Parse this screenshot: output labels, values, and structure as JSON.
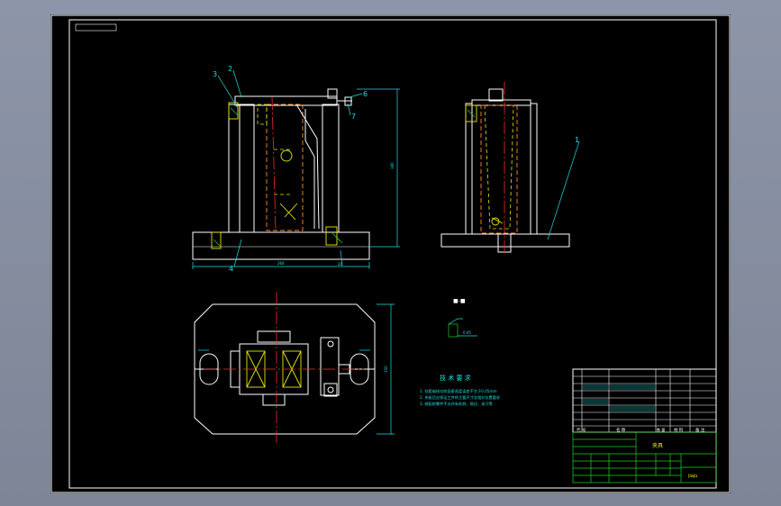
{
  "drawing": {
    "title_block": {
      "drawing_name": "夹具",
      "drawing_code": "jiaju"
    },
    "technical_requirements": {
      "heading": "技 术 要 求",
      "items": [
        "1. 钻套轴线对底面垂直度误差不大于0.05mm",
        "2. 夹紧后应保证工件的主要尺寸及相对位置要求",
        "3. 装配前零件不允许有毛刺、锐边、油污等"
      ]
    },
    "parts_list_header": {
      "code": "代 号",
      "name": "名 称",
      "count": "数 量",
      "material": "材 料",
      "remarks": "备 注"
    },
    "balloons": {
      "b1": "1",
      "b2": "2",
      "b3": "3",
      "b4": "4",
      "b6": "6",
      "b7": "7"
    }
  },
  "colors": {
    "sheet_bg": "#000000",
    "outline": "#ffffff",
    "hidden": "#e8e800",
    "center": "#ff2a2a",
    "dimension": "#1ee0e0",
    "hatch": "#22d022"
  }
}
